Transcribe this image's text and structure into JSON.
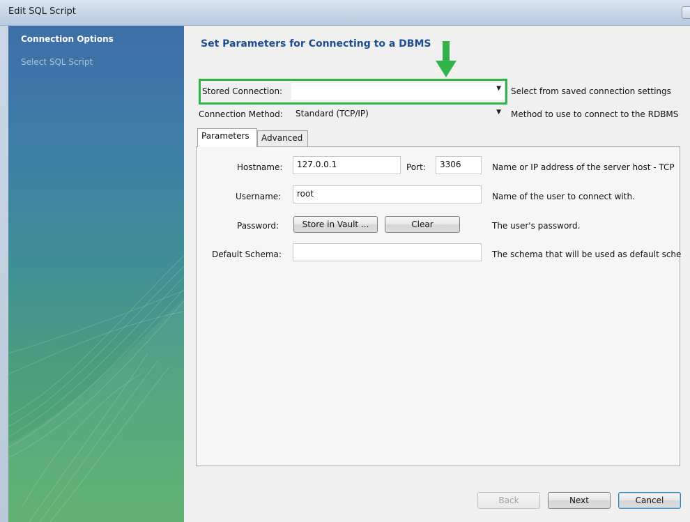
{
  "window": {
    "title": "Edit SQL Script"
  },
  "sidebar": {
    "items": [
      {
        "label": "Connection Options",
        "active": true
      },
      {
        "label": "Select SQL Script",
        "active": false
      }
    ]
  },
  "main": {
    "heading": "Set Parameters for Connecting to a DBMS",
    "stored_connection": {
      "label": "Stored Connection:",
      "value": "",
      "description": "Select from saved connection settings"
    },
    "connection_method": {
      "label": "Connection Method:",
      "value": "Standard (TCP/IP)",
      "description": "Method to use to connect to the RDBMS"
    },
    "tabs": [
      {
        "label": "Parameters",
        "selected": true
      },
      {
        "label": "Advanced",
        "selected": false
      }
    ],
    "parameters": {
      "hostname": {
        "label": "Hostname:",
        "value": "127.0.0.1",
        "description": "Name or IP address of the server host - TCP"
      },
      "port": {
        "label": "Port:",
        "value": "3306"
      },
      "username": {
        "label": "Username:",
        "value": "root",
        "description": "Name of the user to connect with."
      },
      "password": {
        "label": "Password:",
        "store_button": "Store in Vault ...",
        "clear_button": "Clear",
        "description": "The user's password."
      },
      "default_schema": {
        "label": "Default Schema:",
        "value": "",
        "description": "The schema that will be used as default sche"
      }
    }
  },
  "footer": {
    "back_label": "Back",
    "next_label": "Next",
    "cancel_label": "Cancel"
  },
  "colors": {
    "heading": "#1e4f91",
    "highlight": "#33b24a",
    "arrow": "#33b24a"
  },
  "icons": {
    "arrow": "down-arrow-icon",
    "dropdown": "chevron-down-icon"
  }
}
